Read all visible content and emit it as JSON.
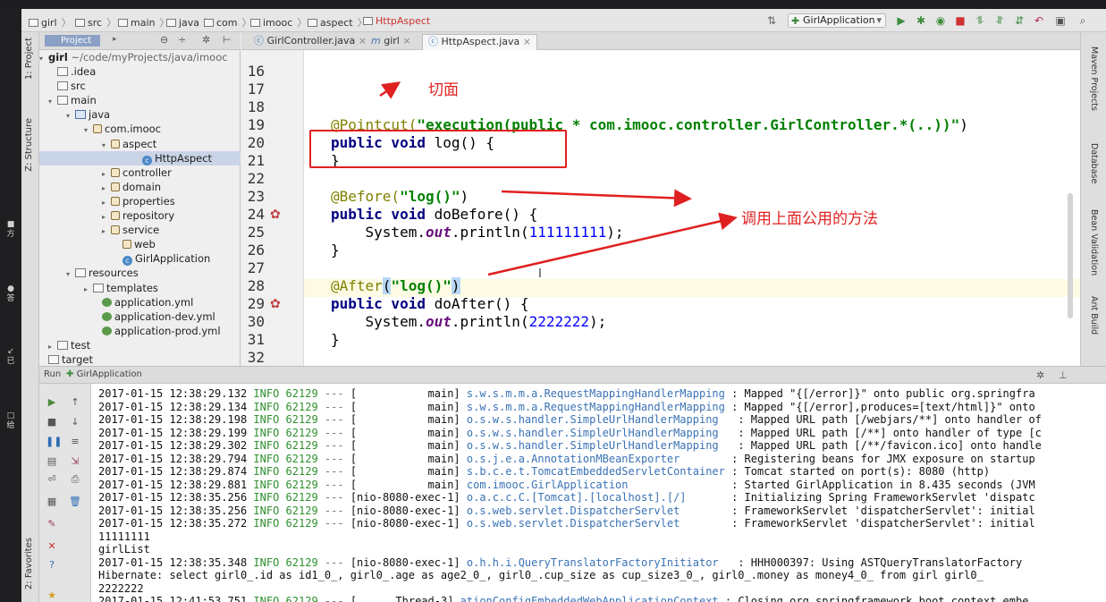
{
  "breadcrumbs": [
    {
      "label": "girl",
      "red": false
    },
    {
      "label": "src",
      "red": false
    },
    {
      "label": "main",
      "red": false
    },
    {
      "label": "java",
      "red": false
    },
    {
      "label": "com",
      "red": false
    },
    {
      "label": "imooc",
      "red": false
    },
    {
      "label": "aspect",
      "red": false
    },
    {
      "label": "HttpAspect",
      "red": true
    }
  ],
  "run_config": "GirlApplication",
  "left_tools": {
    "project": "1: Project",
    "structure": "Z: Structure",
    "favorites": "2: Favorites"
  },
  "right_tools": [
    "Maven Projects",
    "Database",
    "Bean Validation",
    "Ant Build"
  ],
  "project_panel": {
    "title": "Project",
    "root": "girl",
    "root_path": "~/code/myProjects/java/imooc",
    "items": [
      {
        "label": ".idea"
      },
      {
        "label": "src"
      },
      {
        "label": "main"
      },
      {
        "label": "java"
      },
      {
        "label": "com.imooc"
      },
      {
        "label": "aspect"
      },
      {
        "label": "HttpAspect"
      },
      {
        "label": "controller"
      },
      {
        "label": "domain"
      },
      {
        "label": "properties"
      },
      {
        "label": "repository"
      },
      {
        "label": "service"
      },
      {
        "label": "web"
      },
      {
        "label": "GirlApplication"
      },
      {
        "label": "resources"
      },
      {
        "label": "templates"
      },
      {
        "label": "application.yml"
      },
      {
        "label": "application-dev.yml"
      },
      {
        "label": "application-prod.yml"
      },
      {
        "label": "test"
      },
      {
        "label": "target"
      }
    ]
  },
  "tabs": [
    {
      "label": "GirlController.java"
    },
    {
      "label": "girl"
    },
    {
      "label": "HttpAspect.java"
    }
  ],
  "editor": {
    "line_numbers": [
      "16",
      "17",
      "18",
      "19",
      "20",
      "21",
      "22",
      "23",
      "24",
      "25",
      "26",
      "27",
      "28",
      "29",
      "30",
      "31",
      "32"
    ],
    "lines": {
      "l19_ann": "@Pointcut(",
      "l19_str": "\"execution(public * com.imooc.controller.GirlController.*(..))\"",
      "l19_end": ")",
      "l20_kw": "public void",
      "l20_rest": " log() {",
      "l21": "}",
      "l23_ann": "@Before(",
      "l23_str": "\"log()\"",
      "l23_end": ")",
      "l24_kw": "public void",
      "l24_rest": " doBefore() {",
      "l25_a": "    System.",
      "l25_out": "out",
      "l25_b": ".println(",
      "l25_num": "111111111",
      "l25_c": ");",
      "l26": "}",
      "l28_ann": "@After",
      "l28_p": "(",
      "l28_str": "\"log()\"",
      "l28_end": ")",
      "l29_kw": "public void",
      "l29_rest": " doAfter() {",
      "l30_a": "    System.",
      "l30_out": "out",
      "l30_b": ".println(",
      "l30_num": "2222222",
      "l30_c": ");",
      "l31": "}"
    }
  },
  "annotations": {
    "cut": "切面",
    "call": "调用上面公用的方法"
  },
  "run_panel": {
    "label": "Run",
    "config": "GirlApplication"
  },
  "console": [
    {
      "ts": "2017-01-15 12:38:29.132",
      "lvl": "INFO",
      "pid": "62129",
      "sep": "---",
      "thr": "[           main]",
      "log": "s.w.s.m.m.a.RequestMappingHandlerMapping",
      "msg": ": Mapped \"{[/error]}\" onto public org.springfra"
    },
    {
      "ts": "2017-01-15 12:38:29.134",
      "lvl": "INFO",
      "pid": "62129",
      "sep": "---",
      "thr": "[           main]",
      "log": "s.w.s.m.m.a.RequestMappingHandlerMapping",
      "msg": ": Mapped \"{[/error],produces=[text/html]}\" onto"
    },
    {
      "ts": "2017-01-15 12:38:29.198",
      "lvl": "INFO",
      "pid": "62129",
      "sep": "---",
      "thr": "[           main]",
      "log": "o.s.w.s.handler.SimpleUrlHandlerMapping  ",
      "msg": ": Mapped URL path [/webjars/**] onto handler of"
    },
    {
      "ts": "2017-01-15 12:38:29.199",
      "lvl": "INFO",
      "pid": "62129",
      "sep": "---",
      "thr": "[           main]",
      "log": "o.s.w.s.handler.SimpleUrlHandlerMapping  ",
      "msg": ": Mapped URL path [/**] onto handler of type [c"
    },
    {
      "ts": "2017-01-15 12:38:29.302",
      "lvl": "INFO",
      "pid": "62129",
      "sep": "---",
      "thr": "[           main]",
      "log": "o.s.w.s.handler.SimpleUrlHandlerMapping  ",
      "msg": ": Mapped URL path [/**/favicon.ico] onto handle"
    },
    {
      "ts": "2017-01-15 12:38:29.794",
      "lvl": "INFO",
      "pid": "62129",
      "sep": "---",
      "thr": "[           main]",
      "log": "o.s.j.e.a.AnnotationMBeanExporter       ",
      "msg": ": Registering beans for JMX exposure on startup"
    },
    {
      "ts": "2017-01-15 12:38:29.874",
      "lvl": "INFO",
      "pid": "62129",
      "sep": "---",
      "thr": "[           main]",
      "log": "s.b.c.e.t.TomcatEmbeddedServletContainer",
      "msg": ": Tomcat started on port(s): 8080 (http)"
    },
    {
      "ts": "2017-01-15 12:38:29.881",
      "lvl": "INFO",
      "pid": "62129",
      "sep": "---",
      "thr": "[           main]",
      "log": "com.imooc.GirlApplication               ",
      "msg": ": Started GirlApplication in 8.435 seconds (JVM"
    },
    {
      "ts": "2017-01-15 12:38:35.256",
      "lvl": "INFO",
      "pid": "62129",
      "sep": "---",
      "thr": "[nio-8080-exec-1]",
      "log": "o.a.c.c.C.[Tomcat].[localhost].[/]      ",
      "msg": ": Initializing Spring FrameworkServlet 'dispatc"
    },
    {
      "ts": "2017-01-15 12:38:35.256",
      "lvl": "INFO",
      "pid": "62129",
      "sep": "---",
      "thr": "[nio-8080-exec-1]",
      "log": "o.s.web.servlet.DispatcherServlet       ",
      "msg": ": FrameworkServlet 'dispatcherServlet': initial"
    },
    {
      "ts": "2017-01-15 12:38:35.272",
      "lvl": "INFO",
      "pid": "62129",
      "sep": "---",
      "thr": "[nio-8080-exec-1]",
      "log": "o.s.web.servlet.DispatcherServlet       ",
      "msg": ": FrameworkServlet 'dispatcherServlet': initial"
    },
    {
      "plain": "11111111"
    },
    {
      "plain": "girlList"
    },
    {
      "ts": "2017-01-15 12:38:35.348",
      "lvl": "INFO",
      "pid": "62129",
      "sep": "---",
      "thr": "[nio-8080-exec-1]",
      "log": "o.h.h.i.QueryTranslatorFactoryInitiator  ",
      "msg": ": HHH000397: Using ASTQueryTranslatorFactory"
    },
    {
      "plain": "Hibernate: select girl0_.id as id1_0_, girl0_.age as age2_0_, girl0_.cup_size as cup_size3_0_, girl0_.money as money4_0_ from girl girl0_"
    },
    {
      "plain": "2222222"
    },
    {
      "ts": "2017-01-15 12:41:53.751",
      "lvl": "INFO",
      "pid": "62129",
      "sep": "---",
      "thr": "[      Thread-3]",
      "log": "ationConfigEmbeddedWebApplicationContext",
      "msg": ": Closing org.springframework.boot.context.embe"
    }
  ],
  "colors": {
    "annotation_red": "#e02020",
    "string_green": "#008000",
    "keyword_navy": "#000080",
    "log_green": "#2f8f2f",
    "log_blue": "#3a72b5"
  }
}
